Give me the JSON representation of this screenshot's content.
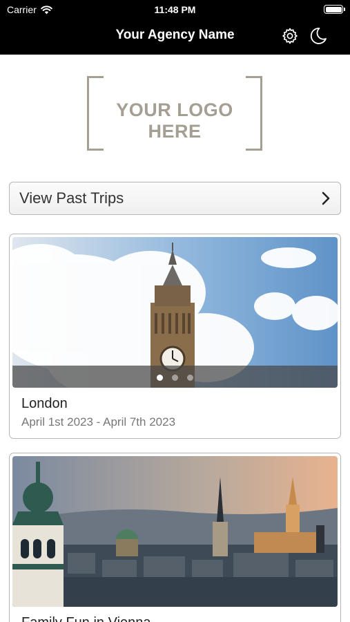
{
  "status_bar": {
    "carrier": "Carrier",
    "time": "11:48 PM"
  },
  "nav": {
    "title": "Your Agency Name",
    "settings_icon": "gear-icon",
    "theme_icon": "moon-icon"
  },
  "logo": {
    "text": "YOUR LOGO HERE"
  },
  "past_trips": {
    "label": "View Past Trips",
    "icon": "chevron-right-icon"
  },
  "trips": [
    {
      "name": "London",
      "dates": "April 1st 2023 - April 7th 2023",
      "photo_count": 3,
      "active_photo": 1
    },
    {
      "name": "Family Fun in Vienna",
      "dates": ""
    }
  ],
  "colors": {
    "header_bg": "#000000",
    "logo_color": "#a59f93",
    "card_border": "#b6b6b6",
    "date_text": "#777777"
  }
}
